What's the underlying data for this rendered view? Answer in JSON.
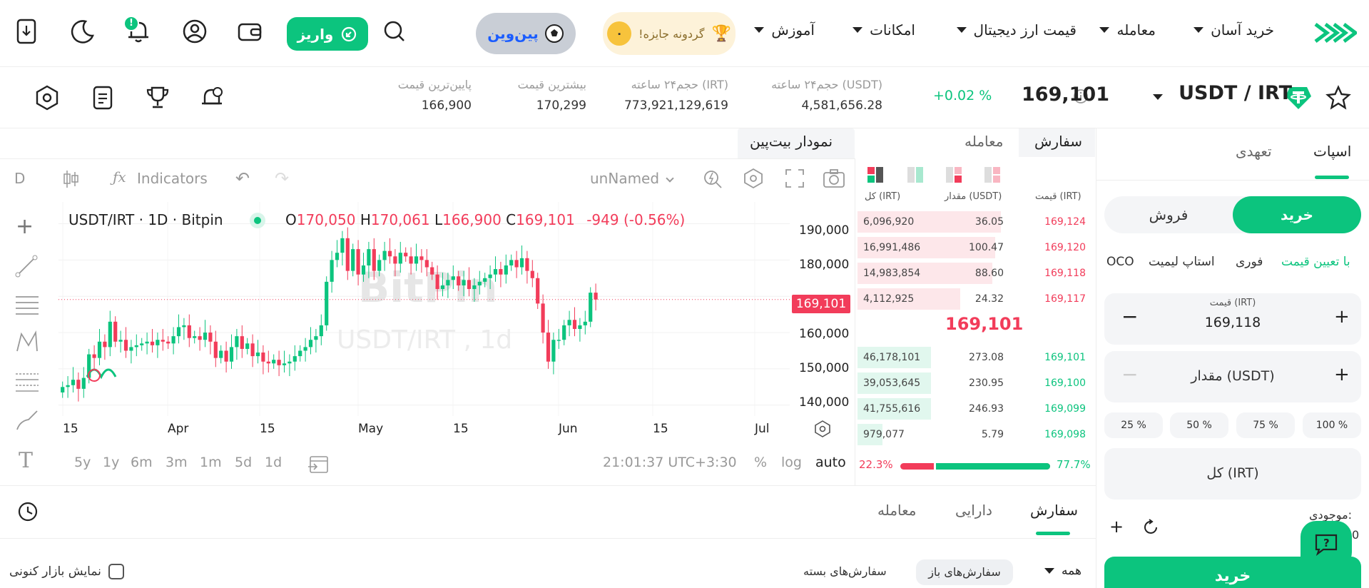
{
  "nav": {
    "items": [
      "خرید آسان",
      "معامله",
      "قیمت ارز دیجیتال",
      "امکانات",
      "آموزش"
    ],
    "prize_label": "گردونه جایزه!",
    "prize_coin": "۰",
    "pinwin_label": "پین‌وین",
    "deposit_label": "واریز",
    "bell_badge": "!"
  },
  "market": {
    "pair": "USDT / IRT",
    "last_price": "169,101",
    "change": "+0.02 %",
    "stats": [
      {
        "label": "حجم۲۴ ساعته (USDT)",
        "value": "4,581,656.28"
      },
      {
        "label": "حجم۲۴ ساعته (IRT)",
        "value": "773,921,129,619"
      },
      {
        "label": "بیشترین قیمت",
        "value": "170,299"
      },
      {
        "label": "پایین‌ترین قیمت",
        "value": "166,900"
      }
    ]
  },
  "panel_tabs": {
    "order": "سفارش",
    "trade": "معامله",
    "chart": "نمودار بیت‌پین"
  },
  "trade_tabs": {
    "spot": "اسپات",
    "margin": "تعهدی"
  },
  "chart_toolbar": {
    "interval": "D",
    "indicators": "Indicators",
    "layout": "unNamed"
  },
  "chart_data": {
    "type": "candlestick",
    "symbol": "USDT/IRT · 1D · Bitpin",
    "ohlc": {
      "o": "170,050",
      "h": "170,061",
      "l": "166,900",
      "c": "169,101",
      "chg": "-949 (-0.56%)"
    },
    "watermark": [
      "BitPin",
      "USDT/IRT , 1d"
    ],
    "y_ticks": [
      "190,000",
      "180,000",
      "169,101",
      "160,000",
      "150,000",
      "140,000"
    ],
    "ylim": [
      137000,
      196000
    ],
    "x_ticks": [
      "15",
      "Apr",
      "15",
      "May",
      "15",
      "Jun",
      "15",
      "Jul"
    ],
    "current_price": 169101,
    "closes": [
      145000,
      145500,
      147000,
      144500,
      147500,
      154000,
      153000,
      157500,
      156000,
      163000,
      157500,
      158000,
      155000,
      156000,
      156500,
      157000,
      157500,
      156500,
      158000,
      157500,
      157000,
      159000,
      161500,
      162000,
      158500,
      159000,
      158000,
      160000,
      157500,
      153000,
      155000,
      152000,
      156000,
      159000,
      155500,
      157000,
      153500,
      154500,
      152000,
      151500,
      152500,
      151000,
      151500,
      152000,
      153500,
      155000,
      156000,
      158000,
      159000,
      162000,
      174000,
      180000,
      182000,
      186000,
      177000,
      183000,
      176000,
      178500,
      183000,
      177000,
      180000,
      182500,
      181000,
      179000,
      182000,
      181000,
      179000,
      181000,
      180000,
      178000,
      176000,
      172000,
      173000,
      174500,
      175500,
      173000,
      174500,
      172000,
      173000,
      174000,
      175000,
      176000,
      177500,
      176000,
      178500,
      180000,
      178000,
      180500,
      177000,
      175000,
      168000,
      160000,
      152000,
      158000,
      158000,
      162000,
      163500,
      161000,
      162000,
      163000,
      171000,
      169101
    ],
    "period": "1y"
  },
  "chart_bottom": {
    "ranges": [
      "5y",
      "1y",
      "6m",
      "3m",
      "1m",
      "5d",
      "1d"
    ],
    "clock": "21:01:37 UTC+3:30",
    "pct": "%",
    "log": "log",
    "auto": "auto"
  },
  "orderbook": {
    "headers": [
      "قیمت (IRT)",
      "مقدار (USDT)",
      "کل (IRT)"
    ],
    "asks": [
      {
        "price": "169,124",
        "amount": "36.05",
        "total": "6,096,920",
        "depth": 0.98
      },
      {
        "price": "169,120",
        "amount": "100.47",
        "total": "16,991,486",
        "depth": 0.94
      },
      {
        "price": "169,118",
        "amount": "88.60",
        "total": "14,983,854",
        "depth": 0.92
      },
      {
        "price": "169,117",
        "amount": "24.32",
        "total": "4,112,925",
        "depth": 0.7
      }
    ],
    "mid": "169,101",
    "bids": [
      {
        "price": "169,101",
        "amount": "273.08",
        "total": "46,178,101",
        "depth": 0.5
      },
      {
        "price": "169,100",
        "amount": "230.95",
        "total": "39,053,645",
        "depth": 0.5
      },
      {
        "price": "169,099",
        "amount": "246.93",
        "total": "41,755,616",
        "depth": 0.5
      },
      {
        "price": "169,098",
        "amount": "5.79",
        "total": "979,077",
        "depth": 0.17
      }
    ],
    "sell_pct": "22.3%",
    "buy_pct": "77.7%",
    "buy_ratio": 0.777
  },
  "trade": {
    "buy": "خرید",
    "sell": "فروش",
    "order_types": [
      "با تعیین قیمت",
      "فوری",
      "استاپ لیمیت",
      "OCO"
    ],
    "price_label": "قیمت (IRT)",
    "price_value": "169,118",
    "amount_label": "مقدار (USDT)",
    "percents": [
      "100 %",
      "75 %",
      "50 %",
      "25 %"
    ],
    "total_label": "کل (IRT)",
    "balance_label": "موجودی:",
    "balance_value": "0",
    "submit": "خرید"
  },
  "orders": {
    "tabs": [
      "سفارش",
      "دارایی",
      "معامله"
    ],
    "filter": "همه",
    "open": "سفارش‌های باز",
    "closed": "سفارش‌های بسته",
    "show_current": "نمایش بازار کنونی"
  },
  "colors": {
    "green": "#0cc47e",
    "red": "#f23c5a"
  }
}
